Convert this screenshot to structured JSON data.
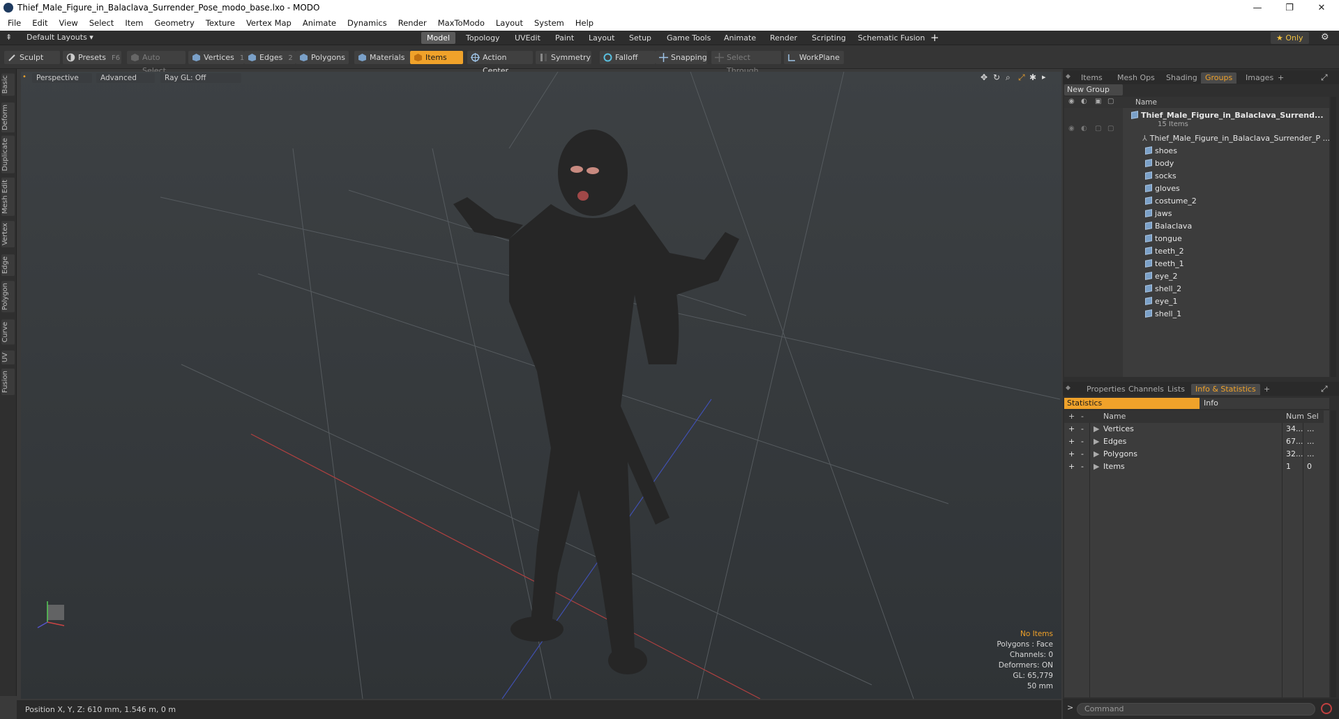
{
  "window": {
    "title": "Thief_Male_Figure_in_Balaclava_Surrender_Pose_modo_base.lxo - MODO",
    "controls": [
      "—",
      "❐",
      "✕"
    ]
  },
  "menubar": [
    "File",
    "Edit",
    "View",
    "Select",
    "Item",
    "Geometry",
    "Texture",
    "Vertex Map",
    "Animate",
    "Dynamics",
    "Render",
    "MaxToModo",
    "Layout",
    "System",
    "Help"
  ],
  "layoutbar": {
    "layout_label": "Default Layouts ▾",
    "tabs": [
      "Model",
      "Topology",
      "UVEdit",
      "Paint",
      "Layout",
      "Setup",
      "Game Tools",
      "Animate",
      "Render",
      "Scripting",
      "Schematic Fusion"
    ],
    "active_tab": "Model",
    "add": "+",
    "only_label": "★ Only",
    "gear": "⚙"
  },
  "toolbar": {
    "sculpt": "Sculpt",
    "presets": "Presets",
    "presets_key": "F6",
    "auto_select": "Auto Select",
    "vertices": "Vertices",
    "vertices_num": "1",
    "edges": "Edges",
    "edges_num": "2",
    "polygons": "Polygons",
    "materials": "Materials",
    "items": "Items",
    "action_center": "Action Center",
    "symmetry": "Symmetry",
    "falloff": "Falloff",
    "snapping": "Snapping",
    "select_through": "Select Through",
    "workplane": "WorkPlane"
  },
  "lefttabs": [
    "Basic",
    "Deform",
    "Duplicate",
    "Mesh Edit",
    "Vertex",
    "Edge",
    "Polygon",
    "Curve",
    "UV",
    "Fusion"
  ],
  "viewport": {
    "perspective": "Perspective",
    "advanced": "Advanced",
    "raygl": "Ray GL: Off",
    "overlay": {
      "no_items": "No Items",
      "polygons": "Polygons : Face",
      "channels": "Channels: 0",
      "deformers": "Deformers: ON",
      "gl": "GL: 65,779",
      "size": "50 mm"
    }
  },
  "statusbar": {
    "position": "Position X, Y, Z:  610 mm, 1.546 m, 0 m"
  },
  "groups_panel": {
    "tabs": [
      "Items",
      "Mesh Ops",
      "Shading",
      "Groups",
      "Images",
      "+"
    ],
    "active_tab": "Groups",
    "new_group": "New Group",
    "name_header": "Name",
    "root_name": "Thief_Male_Figure_in_Balaclava_Surrend...",
    "root_count": "15 Items",
    "mesh_name": "Thief_Male_Figure_in_Balaclava_Surrender_P ...",
    "items": [
      "shoes",
      "body",
      "socks",
      "gloves",
      "costume_2",
      "jaws",
      "Balaclava",
      "tongue",
      "teeth_2",
      "teeth_1",
      "eye_2",
      "shell_2",
      "eye_1",
      "shell_1"
    ]
  },
  "info_panel": {
    "tabs": [
      "Properties",
      "Channels",
      "Lists",
      "Info & Statistics",
      "+"
    ],
    "active_tab": "Info & Statistics",
    "sub_tabs": [
      "Statistics",
      "Info"
    ],
    "headers": {
      "name": "Name",
      "num": "Num",
      "sel": "Sel"
    },
    "rows": [
      {
        "name": "Vertices",
        "num": "34...",
        "sel": "..."
      },
      {
        "name": "Edges",
        "num": "67...",
        "sel": "..."
      },
      {
        "name": "Polygons",
        "num": "32...",
        "sel": "..."
      },
      {
        "name": "Items",
        "num": "1",
        "sel": "0"
      }
    ]
  },
  "command": {
    "prompt": ">",
    "placeholder": "Command"
  }
}
